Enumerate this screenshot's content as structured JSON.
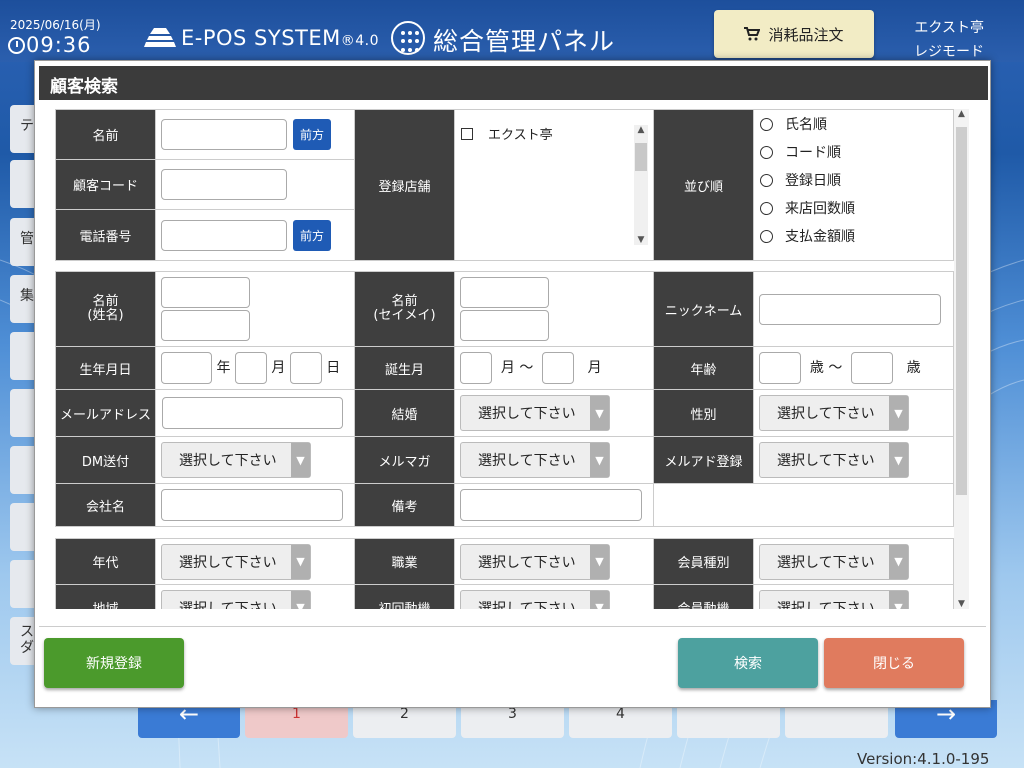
{
  "header": {
    "date": "2025/06/16(月)",
    "time": "09:36",
    "system_name": "E-POS SYSTEM",
    "system_version_mark": "®4.0",
    "panel_title": "総合管理パネル",
    "order_button": "消耗品注文",
    "shop_name": "エクスト亭",
    "mode": "レジモード"
  },
  "side_tabs": [
    "テ",
    "",
    "管",
    "集",
    "",
    "",
    "",
    "",
    "",
    "ス\nダ"
  ],
  "pager": [
    "",
    "1",
    "2",
    "3",
    "4",
    "",
    "",
    ""
  ],
  "version": "Version:4.1.0-195",
  "modal": {
    "title": "顧客検索",
    "row1": {
      "name_label": "名前",
      "code_label": "顧客コード",
      "phone_label": "電話番号",
      "prefix_button": "前方",
      "store_label": "登録店舗",
      "store_option": "エクスト亭",
      "sort_label": "並び順",
      "sort_options": [
        "氏名順",
        "コード順",
        "登録日順",
        "来店回数順",
        "支払金額順"
      ]
    },
    "row2": {
      "name_kanji_label": "名前\n(姓名)",
      "name_kana_label": "名前\n(セイメイ)",
      "nickname_label": "ニックネーム",
      "birthdate_label": "生年月日",
      "year_unit": "年",
      "month_unit": "月",
      "day_unit": "日",
      "birth_month_label": "誕生月",
      "range_month_from": "月 ～",
      "range_month_to": "月",
      "age_label": "年齢",
      "age_from": "歳 ～",
      "age_to": "歳",
      "email_label": "メールアドレス",
      "marriage_label": "結婚",
      "gender_label": "性別",
      "dm_label": "DM送付",
      "magazine_label": "メルマガ",
      "email_reg_label": "メルアド登録",
      "company_label": "会社名",
      "note_label": "備考"
    },
    "row3": {
      "age_group_label": "年代",
      "job_label": "職業",
      "member_type_label": "会員種別",
      "region_label": "地域",
      "first_motive_label": "初回動機",
      "join_motive_label": "会員動機"
    },
    "select_placeholder": "選択して下さい",
    "buttons": {
      "new": "新規登録",
      "search": "検索",
      "close": "閉じる"
    }
  },
  "colors": {
    "header_bg": "#3b3b3b",
    "prefix_button": "#1f5bb5",
    "new_button": "#4b9a2c",
    "search_button": "#4da19f",
    "close_button": "#e07b5e",
    "order_button": "#f2ecc5"
  }
}
